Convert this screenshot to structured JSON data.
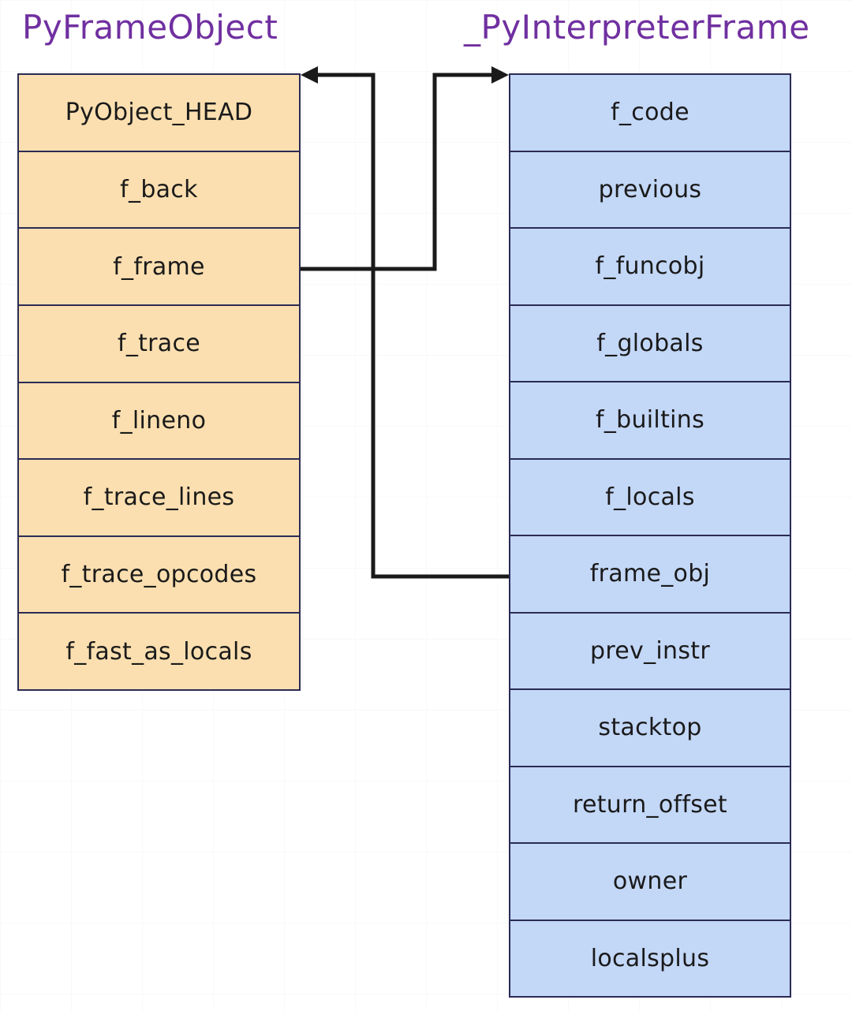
{
  "diagram": {
    "title_left": "PyFrameObject",
    "title_right": "_PyInterpreterFrame",
    "colors": {
      "title": "#7030A0",
      "left_fill": "#FBDFB0",
      "right_fill": "#C3D7F7",
      "border": "#2B2B55",
      "connector": "#1a1a1a",
      "background": "#ffffff"
    }
  },
  "pyframeobject": {
    "name": "PyFrameObject",
    "fields": [
      {
        "label": "PyObject_HEAD"
      },
      {
        "label": "f_back"
      },
      {
        "label": "f_frame"
      },
      {
        "label": "f_trace"
      },
      {
        "label": "f_lineno"
      },
      {
        "label": "f_trace_lines"
      },
      {
        "label": "f_trace_opcodes"
      },
      {
        "label": "f_fast_as_locals"
      }
    ]
  },
  "interpreterframe": {
    "name": "_PyInterpreterFrame",
    "fields": [
      {
        "label": "f_code"
      },
      {
        "label": "previous"
      },
      {
        "label": "f_funcobj"
      },
      {
        "label": "f_globals"
      },
      {
        "label": "f_builtins"
      },
      {
        "label": "f_locals"
      },
      {
        "label": "frame_obj"
      },
      {
        "label": "prev_instr"
      },
      {
        "label": "stacktop"
      },
      {
        "label": "return_offset"
      },
      {
        "label": "owner"
      },
      {
        "label": "localsplus"
      }
    ]
  },
  "connectors": [
    {
      "name": "f_frame-to-interpreterframe",
      "from_field": "f_frame",
      "to_struct": "_PyInterpreterFrame",
      "direction": "right"
    },
    {
      "name": "frame_obj-to-pyframeobject",
      "from_field": "frame_obj",
      "to_struct": "PyFrameObject",
      "direction": "left"
    }
  ]
}
